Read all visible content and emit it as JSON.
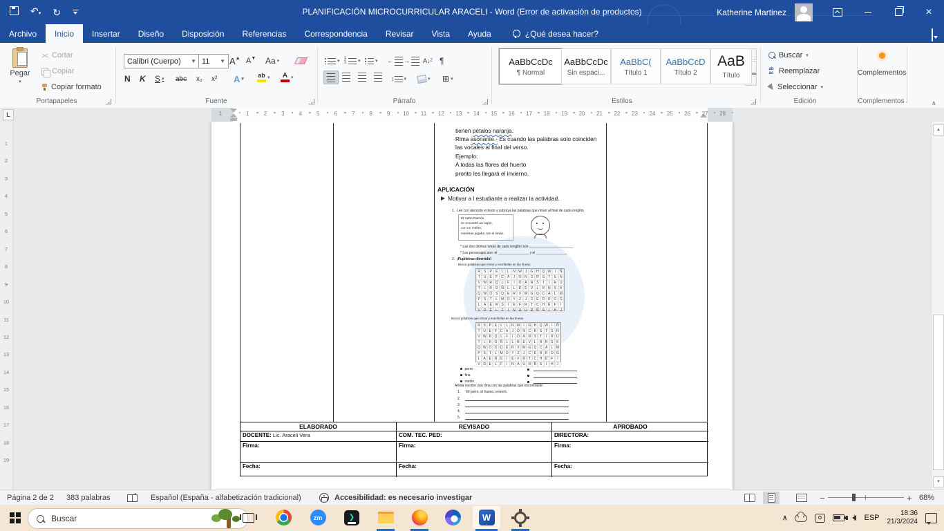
{
  "colors": {
    "titlebar_blue": "#1f4e9f",
    "accent_blue": "#2b579a",
    "taskbar_bg": "#f4e6d3",
    "run_indicator": "#1273d4",
    "addin_dot": "#f7941d",
    "highlight_yellow": "#ffe100",
    "font_color_red": "#c00000",
    "heading_blue": "#2e74b5"
  },
  "titlebar": {
    "title": "PLANIFICACIÓN MICROCURRICULAR ARACELI  -  Word (Error de activación de productos)",
    "user": "Katherine Martinez"
  },
  "menubar": {
    "tabs": [
      {
        "label": "Archivo",
        "active": false
      },
      {
        "label": "Inicio",
        "active": true
      },
      {
        "label": "Insertar",
        "active": false
      },
      {
        "label": "Diseño",
        "active": false
      },
      {
        "label": "Disposición",
        "active": false
      },
      {
        "label": "Referencias",
        "active": false
      },
      {
        "label": "Correspondencia",
        "active": false
      },
      {
        "label": "Revisar",
        "active": false
      },
      {
        "label": "Vista",
        "active": false
      },
      {
        "label": "Ayuda",
        "active": false
      }
    ],
    "tellme": "¿Qué desea hacer?"
  },
  "ribbon": {
    "clipboard": {
      "label": "Portapapeles",
      "paste": "Pegar",
      "cut": "Cortar",
      "copy": "Copiar",
      "format_painter": "Copiar formato"
    },
    "font": {
      "label": "Fuente",
      "family": "Calibri (Cuerpo)",
      "size": "11",
      "bold": "N",
      "italic": "K",
      "underline": "S",
      "strikethrough": "abc",
      "subscript": "x₂",
      "superscript": "x²",
      "grow": "A",
      "shrink": "A",
      "change_case": "Aa",
      "effects": "A",
      "highlight_glyph": "ab",
      "color_glyph": "A"
    },
    "paragraph": {
      "label": "Párrafo",
      "sort_glyph": "A↓",
      "pilcrow": "¶",
      "spacing_glyph": "↕",
      "borders_glyph": "⊞",
      "outdent_glyph": "←",
      "indent_glyph": "→"
    },
    "styles": {
      "label": "Estilos",
      "items": [
        {
          "preview": "AaBbCcDc",
          "name": "¶ Normal",
          "kind": "normal",
          "selected": true
        },
        {
          "preview": "AaBbCcDc",
          "name": "Sin espaci...",
          "kind": "normal",
          "selected": false
        },
        {
          "preview": "AaBbC(",
          "name": "Título 1",
          "kind": "h1",
          "selected": false
        },
        {
          "preview": "AaBbCcD",
          "name": "Título 2",
          "kind": "h2",
          "selected": false
        },
        {
          "preview": "AaB",
          "name": "Título",
          "kind": "title",
          "selected": false
        }
      ]
    },
    "editing": {
      "label": "Edición",
      "find": "Buscar",
      "replace": "Reemplazar",
      "select": "Seleccionar"
    },
    "addins": {
      "label": "Complementos",
      "button": "Complementos"
    }
  },
  "ruler": {
    "lead": "1",
    "first": 1,
    "last": 28,
    "vertical_first": 1,
    "vertical_last": 19
  },
  "document": {
    "para_lines": [
      {
        "pre": "tienen ",
        "sq": "pétalos naranja",
        "post": "."
      },
      {
        "pre": "Rima ",
        "sq": "asonante.-",
        "post": "  Es cuando las palabras solo coinciden"
      },
      {
        "pre": "las vocales al final del verso.",
        "sq": "",
        "post": ""
      },
      {
        "pre": "Ejemplo:",
        "sq": "",
        "post": ""
      },
      {
        "pre": "A todas las flores del huerto",
        "sq": "",
        "post": ""
      },
      {
        "pre": "pronto les llegará el invierno.",
        "sq": "",
        "post": ""
      }
    ],
    "heading": "APLICACIÓN",
    "activity_item": "Motivar a l estudiante a realizar la actividad.",
    "worksheet": {
      "item1_num": "1.",
      "item1": "Lee con atención el texto y subraya las palabras que riman al final de cada renglón",
      "poem": [
        "El ratón Ramón,",
        "se encontró un cajón,",
        "con un melón,",
        "mientras jugaba con el limón."
      ],
      "q1": "*   Las dos últimas letras de cada renglón son  _______________________",
      "q2": "*   Los personajes son: el  ________________  y el  ________________",
      "item2_num": "2.",
      "item2": "¡Pupiletras divertido!",
      "caption1": "Busca palabras que riman y escríbelas en las líneas.",
      "caption2": "Busca palabras que riman y escríbelas en las líneas.",
      "grid1": [
        "RSPELLNWJGHQWIÑ",
        "TUEFCAJONCRSTSN",
        "VWRQLFIOARSTIRU",
        "TLROÑLLREVLRNSK",
        "QWOSQERXWGQCALM",
        "PSTLMOYZJCERROG",
        "LAERSIEFRTCHEFI",
        "VDELFINAURÑSIHJ"
      ],
      "grid2": [
        "RSPELLNWIGHQWIÑ",
        "TUEFCAJONCRSTSN",
        "VWRQLFIOARSTIRU",
        "TLROÑLLREVLRNSK",
        "QWOSQERXWGQCALM",
        "PSTLMOYZJCERROG",
        "LAERSIEFRTCHEFI",
        "VDELFINAURÑSIHJ"
      ],
      "found_words": [
        "perro",
        "fina",
        "melón"
      ],
      "rhyme_prompt": "Ahora escribe una rima con las palabras que encontraste:",
      "rhyme_lines": [
        {
          "num": "1.",
          "text": "El perro, el hueso, enterró."
        },
        {
          "num": "2.",
          "text": ""
        },
        {
          "num": "3.",
          "text": ""
        },
        {
          "num": "4.",
          "text": ""
        },
        {
          "num": "5.",
          "text": ""
        }
      ]
    },
    "signoff": {
      "columns": [
        {
          "header": "ELABORADO",
          "role": "DOCENTE:",
          "value": "Lic. Araceli Vera"
        },
        {
          "header": "REVISADO",
          "role": "COM. TEC. PED:",
          "value": ""
        },
        {
          "header": "APROBADO",
          "role": "DIRECTORA:",
          "value": ""
        }
      ],
      "firma": "Firma:",
      "fecha": "Fecha:"
    }
  },
  "statusbar": {
    "page": "Página 2 de 2",
    "words": "383 palabras",
    "language": "Español (España - alfabetización tradicional)",
    "accessibility": "Accesibilidad: es necesario investigar",
    "zoom": "68%"
  },
  "taskbar": {
    "search_placeholder": "Buscar",
    "apps": [
      {
        "id": "task-view",
        "running": false,
        "active": false
      },
      {
        "id": "chrome",
        "running": false,
        "active": false
      },
      {
        "id": "zoom",
        "glyph": "zm",
        "running": false,
        "active": false
      },
      {
        "id": "media-app",
        "glyph": "❯",
        "running": false,
        "active": false
      },
      {
        "id": "file-explorer",
        "running": true,
        "active": false
      },
      {
        "id": "firefox",
        "running": true,
        "active": false
      },
      {
        "id": "microsoft-365",
        "running": false,
        "active": false
      },
      {
        "id": "word",
        "glyph": "W",
        "running": true,
        "active": true
      },
      {
        "id": "settings",
        "running": true,
        "active": false
      }
    ],
    "tray": {
      "lang": "ESP",
      "time": "18:36",
      "date": "21/3/2024"
    }
  }
}
